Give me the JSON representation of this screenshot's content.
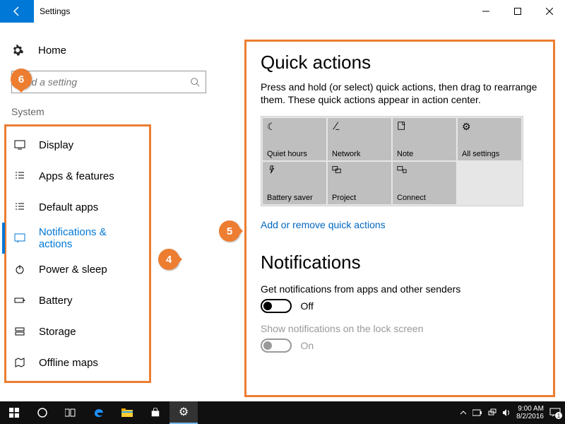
{
  "window": {
    "title": "Settings",
    "min": "—",
    "max": "▢",
    "close": "✕"
  },
  "sidebar": {
    "home": "Home",
    "search_placeholder": "Find a setting",
    "section": "System",
    "items": [
      {
        "icon": "display-icon",
        "label": "Display"
      },
      {
        "icon": "apps-icon",
        "label": "Apps & features"
      },
      {
        "icon": "default-apps-icon",
        "label": "Default apps"
      },
      {
        "icon": "notifications-icon",
        "label": "Notifications & actions"
      },
      {
        "icon": "power-icon",
        "label": "Power & sleep"
      },
      {
        "icon": "battery-icon",
        "label": "Battery"
      },
      {
        "icon": "storage-icon",
        "label": "Storage"
      },
      {
        "icon": "maps-icon",
        "label": "Offline maps"
      }
    ]
  },
  "main": {
    "quick_actions": {
      "heading": "Quick actions",
      "description": "Press and hold (or select) quick actions, then drag to rearrange them. These quick actions appear in action center.",
      "tiles": [
        {
          "icon": "moon-icon",
          "label": "Quiet hours"
        },
        {
          "icon": "network-icon",
          "label": "Network"
        },
        {
          "icon": "note-icon",
          "label": "Note"
        },
        {
          "icon": "gear-icon",
          "label": "All settings"
        },
        {
          "icon": "battery-saver-icon",
          "label": "Battery saver"
        },
        {
          "icon": "project-icon",
          "label": "Project"
        },
        {
          "icon": "connect-icon",
          "label": "Connect"
        }
      ],
      "link": "Add or remove quick actions"
    },
    "notifications": {
      "heading": "Notifications",
      "setting1_label": "Get notifications from apps and other senders",
      "setting1_state": "Off",
      "setting2_label": "Show notifications on the lock screen",
      "setting2_state": "On"
    }
  },
  "callouts": {
    "c4": "4",
    "c5": "5",
    "c6": "6"
  },
  "taskbar": {
    "time": "9:00 AM",
    "date": "8/2/2016"
  }
}
